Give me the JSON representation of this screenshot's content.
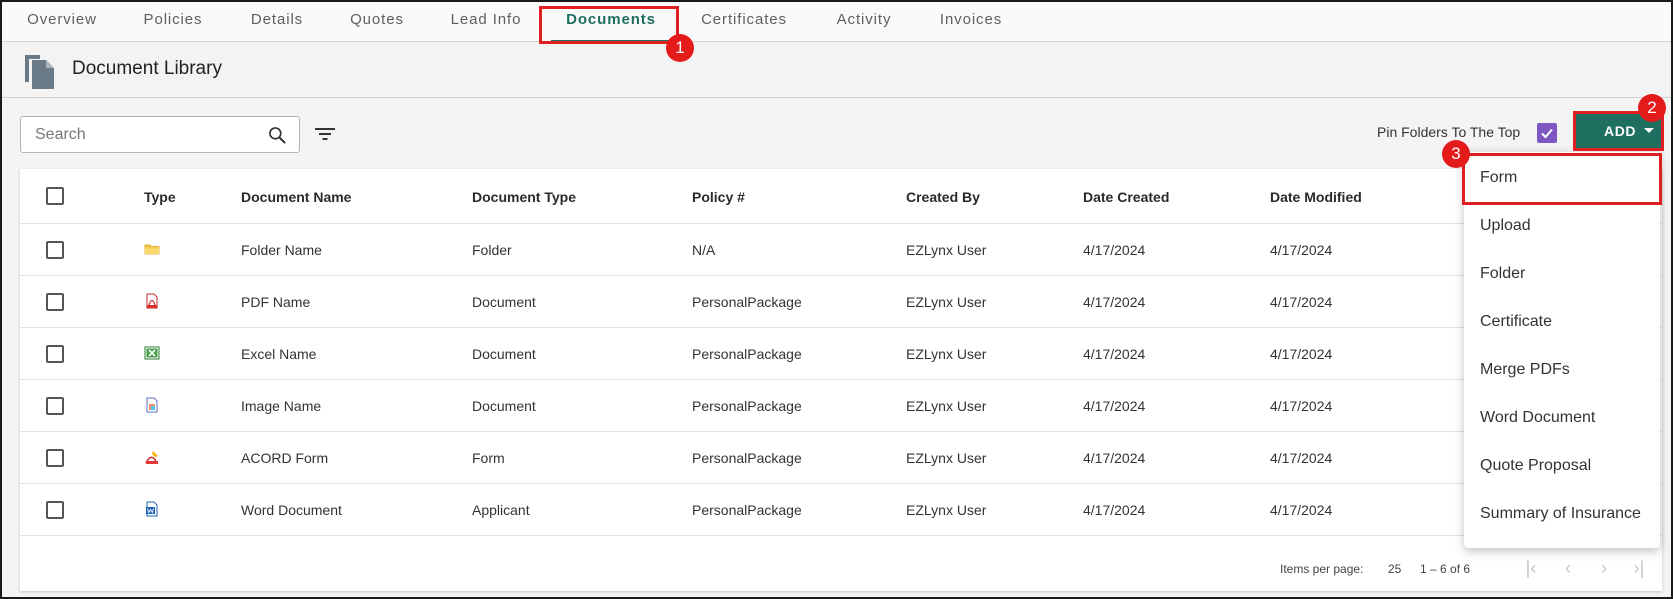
{
  "tabs": [
    {
      "label": "Overview"
    },
    {
      "label": "Policies"
    },
    {
      "label": "Details"
    },
    {
      "label": "Quotes"
    },
    {
      "label": "Lead Info"
    },
    {
      "label": "Documents",
      "active": true
    },
    {
      "label": "Certificates"
    },
    {
      "label": "Activity"
    },
    {
      "label": "Invoices"
    }
  ],
  "header": {
    "title": "Document Library",
    "icon": "documents-icon"
  },
  "toolbar": {
    "search_placeholder": "Search",
    "pin_label": "Pin Folders To The Top",
    "pin_checked": true,
    "add_label": "ADD"
  },
  "table": {
    "columns": [
      "Type",
      "Document Name",
      "Document Type",
      "Policy #",
      "Created By",
      "Date Created",
      "Date Modified"
    ],
    "rows": [
      {
        "icon": "folder-icon",
        "name": "Folder Name",
        "doc_type": "Folder",
        "policy": "N/A",
        "created_by": "EZLynx User",
        "date_created": "4/17/2024",
        "date_modified": "4/17/2024"
      },
      {
        "icon": "pdf-icon",
        "name": "PDF Name",
        "doc_type": "Document",
        "policy": "PersonalPackage",
        "created_by": "EZLynx User",
        "date_created": "4/17/2024",
        "date_modified": "4/17/2024"
      },
      {
        "icon": "excel-icon",
        "name": "Excel Name",
        "doc_type": "Document",
        "policy": "PersonalPackage",
        "created_by": "EZLynx User",
        "date_created": "4/17/2024",
        "date_modified": "4/17/2024"
      },
      {
        "icon": "image-icon",
        "name": "Image Name",
        "doc_type": "Document",
        "policy": "PersonalPackage",
        "created_by": "EZLynx User",
        "date_created": "4/17/2024",
        "date_modified": "4/17/2024"
      },
      {
        "icon": "acord-form-icon",
        "name": "ACORD Form",
        "doc_type": "Form",
        "policy": "PersonalPackage",
        "created_by": "EZLynx User",
        "date_created": "4/17/2024",
        "date_modified": "4/17/2024"
      },
      {
        "icon": "word-icon",
        "name": "Word Document",
        "doc_type": "Applicant",
        "policy": "PersonalPackage",
        "created_by": "EZLynx User",
        "date_created": "4/17/2024",
        "date_modified": "4/17/2024"
      }
    ]
  },
  "paginator": {
    "items_label": "Items per page:",
    "page_size": "25",
    "range": "1 – 6 of 6"
  },
  "add_menu": {
    "items": [
      "Form",
      "Upload",
      "Folder",
      "Certificate",
      "Merge PDFs",
      "Word Document",
      "Quote Proposal",
      "Summary of Insurance"
    ]
  },
  "callouts": [
    "1",
    "2",
    "3"
  ],
  "colors": {
    "accent": "#1f6f60",
    "checkbox": "#7e57c2",
    "callout": "#e41b1b"
  }
}
